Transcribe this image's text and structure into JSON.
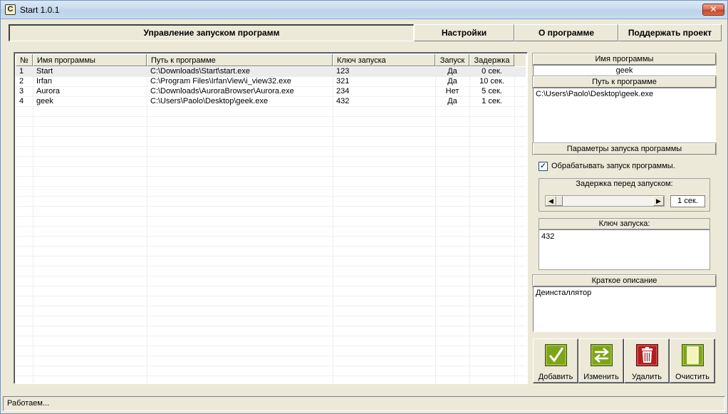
{
  "window": {
    "title": "Start 1.0.1",
    "app_icon_glyph": "C",
    "close_glyph": "✕"
  },
  "tabs": [
    {
      "label": "Управление запуском программ",
      "active": true
    },
    {
      "label": "Настройки",
      "active": false
    },
    {
      "label": "О программе",
      "active": false
    },
    {
      "label": "Поддержать проект",
      "active": false
    }
  ],
  "table": {
    "columns": [
      "№",
      "Имя программы",
      "Путь к программе",
      "Ключ запуска",
      "Запуск",
      "Задержка"
    ],
    "rows": [
      {
        "num": "1",
        "name": "Start",
        "path": "C:\\Downloads\\Start\\start.exe",
        "key": "123",
        "launch": "Да",
        "delay": "0 сек."
      },
      {
        "num": "2",
        "name": "Irfan",
        "path": "C:\\Program Files\\IrfanView\\i_view32.exe",
        "key": "321",
        "launch": "Да",
        "delay": "10 сек."
      },
      {
        "num": "3",
        "name": "Aurora",
        "path": "C:\\Downloads\\AuroraBrowser\\Aurora.exe",
        "key": "234",
        "launch": "Нет",
        "delay": "5 сек."
      },
      {
        "num": "4",
        "name": "geek",
        "path": "C:\\Users\\Paolo\\Desktop\\geek.exe",
        "key": "432",
        "launch": "Да",
        "delay": "1 сек."
      }
    ]
  },
  "details": {
    "name_header": "Имя программы",
    "name_value": "geek",
    "path_header": "Путь к программе",
    "path_value": "C:\\Users\\Paolo\\Desktop\\geek.exe",
    "params_header": "Параметры запуска программы",
    "process_checkbox_label": "Обрабатывать запуск программы.",
    "process_checked": true,
    "delay_group_title": "Задержка перед запуском:",
    "delay_value": "1 сек.",
    "delay_slider_fraction": 0.0,
    "key_group_title": "Ключ запуска:",
    "key_value": "432",
    "description_header": "Краткое описание",
    "description_value": "Деинсталлятор"
  },
  "actions": [
    {
      "label": "Добавить",
      "icon": "checkmark-icon",
      "color": "#6b8e00"
    },
    {
      "label": "Изменить",
      "icon": "swap-arrows-icon",
      "color": "#6b8e00"
    },
    {
      "label": "Удалить",
      "icon": "trash-icon",
      "color": "#b01010"
    },
    {
      "label": "Очистить",
      "icon": "blank-page-icon",
      "color": "#6b8e00"
    }
  ],
  "status": {
    "text": "Работаем..."
  }
}
